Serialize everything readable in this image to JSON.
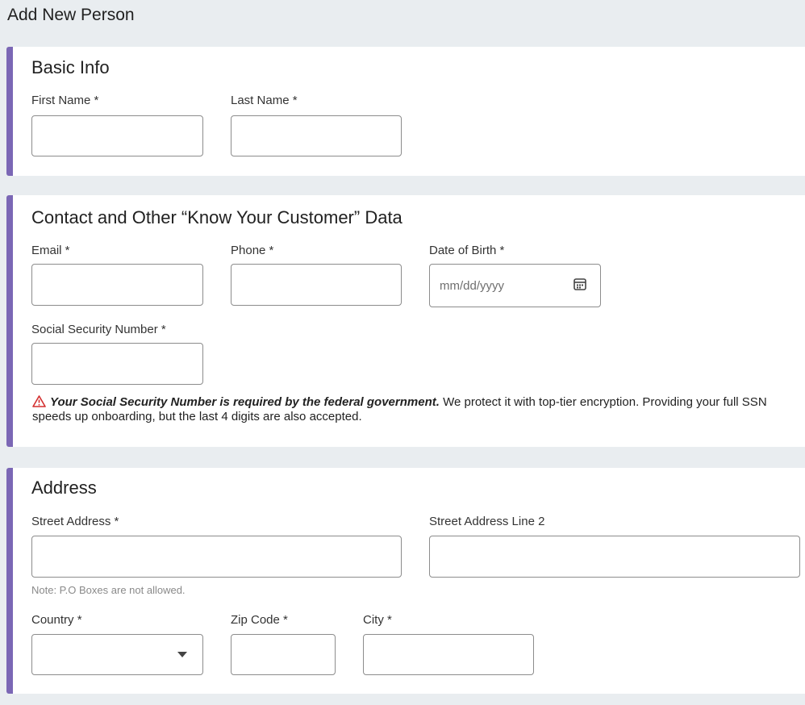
{
  "page": {
    "title": "Add New Person"
  },
  "basic_info": {
    "title": "Basic Info",
    "first_name_label": "First Name *",
    "first_name_value": "",
    "last_name_label": "Last Name *",
    "last_name_value": ""
  },
  "contact": {
    "title": "Contact and Other “Know Your Customer” Data",
    "email_label": "Email *",
    "email_value": "",
    "phone_label": "Phone *",
    "phone_value": "",
    "dob_label": "Date of Birth *",
    "dob_placeholder": "mm/dd/yyyy",
    "ssn_label": "Social Security Number *",
    "ssn_value": "",
    "ssn_notice_bold": "Your Social Security Number is required by the federal government.",
    "ssn_notice_rest": " We protect it with top-tier encryption. Providing your full SSN speeds up onboarding, but the last 4 digits are also accepted."
  },
  "address": {
    "title": "Address",
    "street_label": "Street Address *",
    "street_value": "",
    "street_note": "Note: P.O Boxes are not allowed.",
    "street2_label": "Street Address Line 2",
    "street2_value": "",
    "country_label": "Country *",
    "country_value": "",
    "zip_label": "Zip Code *",
    "zip_value": "",
    "city_label": "City *",
    "city_value": ""
  },
  "colors": {
    "accent": "#7b67b5",
    "warning": "#d32f2f",
    "background": "#e9edf0"
  },
  "icons": {
    "dob": "calendar-icon",
    "warning": "warning-triangle-icon",
    "country": "chevron-down-icon"
  }
}
